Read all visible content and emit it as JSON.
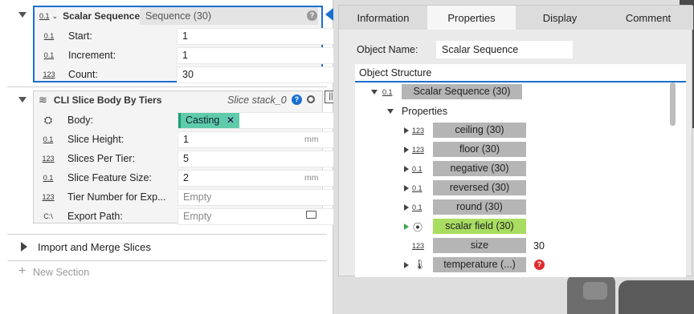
{
  "scalar_sequence": {
    "type_icon": "0.1",
    "title": "Scalar Sequence",
    "subtitle": "Sequence (30)",
    "help": "?",
    "fields": [
      {
        "icon": "0.1",
        "label": "Start:",
        "value": "1"
      },
      {
        "icon": "0.1",
        "label": "Increment:",
        "value": "1"
      },
      {
        "icon": "123",
        "label": "Count:",
        "value": "30"
      }
    ]
  },
  "slice_block": {
    "title": "CLI Slice Body By Tiers",
    "subtitle": "Slice stack_0",
    "help": "?",
    "body": {
      "icon": "body",
      "label": "Body:",
      "tag": "Casting",
      "tag_close": "✕"
    },
    "fields": [
      {
        "icon": "0.1",
        "label": "Slice Height:",
        "value": "1",
        "unit": "mm"
      },
      {
        "icon": "123",
        "label": "Slices Per Tier:",
        "value": "5",
        "unit": ""
      },
      {
        "icon": "0.1",
        "label": "Slice Feature Size:",
        "value": "2",
        "unit": "mm"
      },
      {
        "icon": "123",
        "label": "Tier Number for Exp...",
        "value": "Empty",
        "unit": ""
      },
      {
        "icon": "C:\\",
        "label": "Export Path:",
        "value": "Empty",
        "unit": ""
      }
    ]
  },
  "import_section": {
    "label": "Import and Merge Slices"
  },
  "new_section": {
    "label": "New Section",
    "plus": "+"
  },
  "tabs": [
    {
      "label": "Information",
      "active": false
    },
    {
      "label": "Properties",
      "active": true
    },
    {
      "label": "Display",
      "active": false
    },
    {
      "label": "Comment",
      "active": false
    }
  ],
  "object_name": {
    "label": "Object Name:",
    "value": "Scalar Sequence"
  },
  "object_structure": {
    "header": "Object Structure",
    "root": {
      "label": "Scalar Sequence (30)",
      "icon": "0.1"
    },
    "properties_label": "Properties",
    "items": [
      {
        "icon": "123",
        "label": "ceiling (30)",
        "value": "",
        "highlight": false,
        "warn": false
      },
      {
        "icon": "123",
        "label": "floor (30)",
        "value": "",
        "highlight": false,
        "warn": false
      },
      {
        "icon": "0.1",
        "label": "negative (30)",
        "value": "",
        "highlight": false,
        "warn": false
      },
      {
        "icon": "0.1",
        "label": "reversed (30)",
        "value": "",
        "highlight": false,
        "warn": false
      },
      {
        "icon": "0.1",
        "label": "round (30)",
        "value": "",
        "highlight": false,
        "warn": false
      },
      {
        "icon": "field",
        "label": "scalar field (30)",
        "value": "",
        "highlight": true,
        "warn": false
      },
      {
        "icon": "123",
        "label": "size",
        "value": "30",
        "highlight": false,
        "warn": false
      },
      {
        "icon": "thermo",
        "label": "temperature (...)",
        "value": "",
        "highlight": false,
        "warn": true
      }
    ]
  },
  "colors": {
    "accent": "#1a6fd0",
    "tag": "#5fcbaa",
    "highlight": "#a9dd62",
    "warning": "#e12a2a"
  }
}
